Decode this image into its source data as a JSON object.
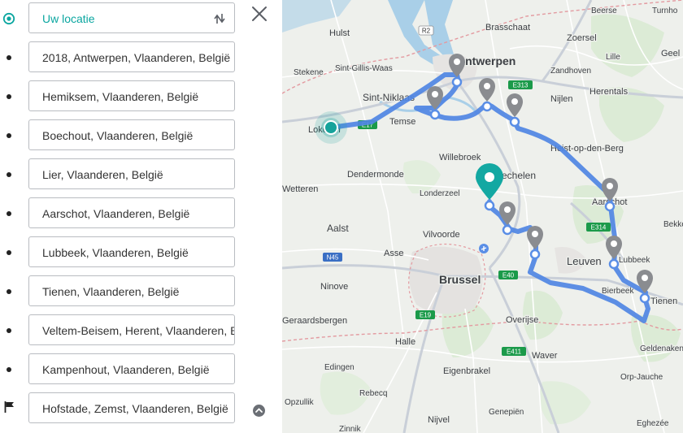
{
  "route": {
    "stops": [
      {
        "label": "Uw locatie",
        "marker": "location-target"
      },
      {
        "label": "2018, Antwerpen, Vlaanderen, België",
        "marker": "bullet"
      },
      {
        "label": "Hemiksem, Vlaanderen, België",
        "marker": "bullet"
      },
      {
        "label": "Boechout, Vlaanderen, België",
        "marker": "bullet"
      },
      {
        "label": "Lier, Vlaanderen, België",
        "marker": "bullet"
      },
      {
        "label": "Aarschot, Vlaanderen, België",
        "marker": "bullet"
      },
      {
        "label": "Lubbeek, Vlaanderen, België",
        "marker": "bullet"
      },
      {
        "label": "Tienen, Vlaanderen, België",
        "marker": "bullet"
      },
      {
        "label": "Veltem-Beisem, Herent, Vlaanderen, België",
        "marker": "bullet"
      },
      {
        "label": "Kampenhout, Vlaanderen, België",
        "marker": "bullet"
      },
      {
        "label": "Hofstade, Zemst, Vlaanderen, België",
        "marker": "flag"
      }
    ],
    "close_icon": "close-icon",
    "swap_icon": "swap-arrows-icon",
    "collapse_icon": "chevron-up-icon"
  },
  "map": {
    "colors": {
      "route": "#5a8ee6",
      "start_marker": "#16a39b",
      "waypoint": "#8a8c90",
      "destination": "#13a8a2"
    },
    "places": [
      {
        "name": "Hulst",
        "size": 11,
        "weight": "normal"
      },
      {
        "name": "Brasschaat",
        "size": 11,
        "weight": "normal"
      },
      {
        "name": "Beerse",
        "size": 10,
        "weight": "normal"
      },
      {
        "name": "Turnho",
        "size": 10,
        "weight": "normal"
      },
      {
        "name": "Zoersel",
        "size": 11,
        "weight": "normal"
      },
      {
        "name": "Antwerpen",
        "size": 14,
        "weight": "bold"
      },
      {
        "name": "Sint-Gillis-Waas",
        "size": 10,
        "weight": "normal"
      },
      {
        "name": "Lille",
        "size": 10,
        "weight": "normal"
      },
      {
        "name": "Geel",
        "size": 11,
        "weight": "normal"
      },
      {
        "name": "Stekene",
        "size": 10,
        "weight": "normal"
      },
      {
        "name": "Zandhoven",
        "size": 10,
        "weight": "normal"
      },
      {
        "name": "Herentals",
        "size": 11,
        "weight": "normal"
      },
      {
        "name": "Sint-Niklaas",
        "size": 12,
        "weight": "normal"
      },
      {
        "name": "Nijlen",
        "size": 11,
        "weight": "normal"
      },
      {
        "name": "Temse",
        "size": 11,
        "weight": "normal"
      },
      {
        "name": "Lokeren",
        "size": 11,
        "weight": "normal"
      },
      {
        "name": "Heist-op-den-Berg",
        "size": 11,
        "weight": "normal"
      },
      {
        "name": "Willebroek",
        "size": 11,
        "weight": "normal"
      },
      {
        "name": "Dendermonde",
        "size": 11,
        "weight": "normal"
      },
      {
        "name": "Mechelen",
        "size": 12,
        "weight": "normal"
      },
      {
        "name": "Wetteren",
        "size": 11,
        "weight": "normal"
      },
      {
        "name": "Londerzeel",
        "size": 10,
        "weight": "normal"
      },
      {
        "name": "Aarschot",
        "size": 11,
        "weight": "normal"
      },
      {
        "name": "Aalst",
        "size": 12,
        "weight": "normal"
      },
      {
        "name": "Vilvoorde",
        "size": 11,
        "weight": "normal"
      },
      {
        "name": "Bekkevoort",
        "size": 10,
        "weight": "normal"
      },
      {
        "name": "Asse",
        "size": 11,
        "weight": "normal"
      },
      {
        "name": "Leuven",
        "size": 13,
        "weight": "normal"
      },
      {
        "name": "Lubbeek",
        "size": 10,
        "weight": "normal"
      },
      {
        "name": "Brussel",
        "size": 14,
        "weight": "bold"
      },
      {
        "name": "Ninove",
        "size": 11,
        "weight": "normal"
      },
      {
        "name": "Bierbeek",
        "size": 10,
        "weight": "normal"
      },
      {
        "name": "Tienen",
        "size": 11,
        "weight": "normal"
      },
      {
        "name": "Geraardsbergen",
        "size": 11,
        "weight": "normal"
      },
      {
        "name": "Overijse",
        "size": 11,
        "weight": "normal"
      },
      {
        "name": "Halle",
        "size": 11,
        "weight": "normal"
      },
      {
        "name": "Geldenaken",
        "size": 10,
        "weight": "normal"
      },
      {
        "name": "Waver",
        "size": 11,
        "weight": "normal"
      },
      {
        "name": "Edingen",
        "size": 10,
        "weight": "normal"
      },
      {
        "name": "Eigenbrakel",
        "size": 11,
        "weight": "normal"
      },
      {
        "name": "Orp-Jauche",
        "size": 10,
        "weight": "normal"
      },
      {
        "name": "Rebecq",
        "size": 10,
        "weight": "normal"
      },
      {
        "name": "Opzullik",
        "size": 10,
        "weight": "normal"
      },
      {
        "name": "Nijvel",
        "size": 11,
        "weight": "normal"
      },
      {
        "name": "Genepiën",
        "size": 10,
        "weight": "normal"
      },
      {
        "name": "Eghezée",
        "size": 10,
        "weight": "normal"
      },
      {
        "name": "Zinnik",
        "size": 10,
        "weight": "normal"
      }
    ],
    "shields": [
      {
        "label": "R2",
        "color": "#ffffff"
      },
      {
        "label": "E313",
        "color": "#1b9a4a"
      },
      {
        "label": "E17",
        "color": "#1b9a4a"
      },
      {
        "label": "E314",
        "color": "#1b9a4a"
      },
      {
        "label": "N45",
        "color": "#3a6fc4"
      },
      {
        "label": "E40",
        "color": "#1b9a4a"
      },
      {
        "label": "E19",
        "color": "#1b9a4a"
      },
      {
        "label": "E411",
        "color": "#1b9a4a"
      }
    ]
  }
}
